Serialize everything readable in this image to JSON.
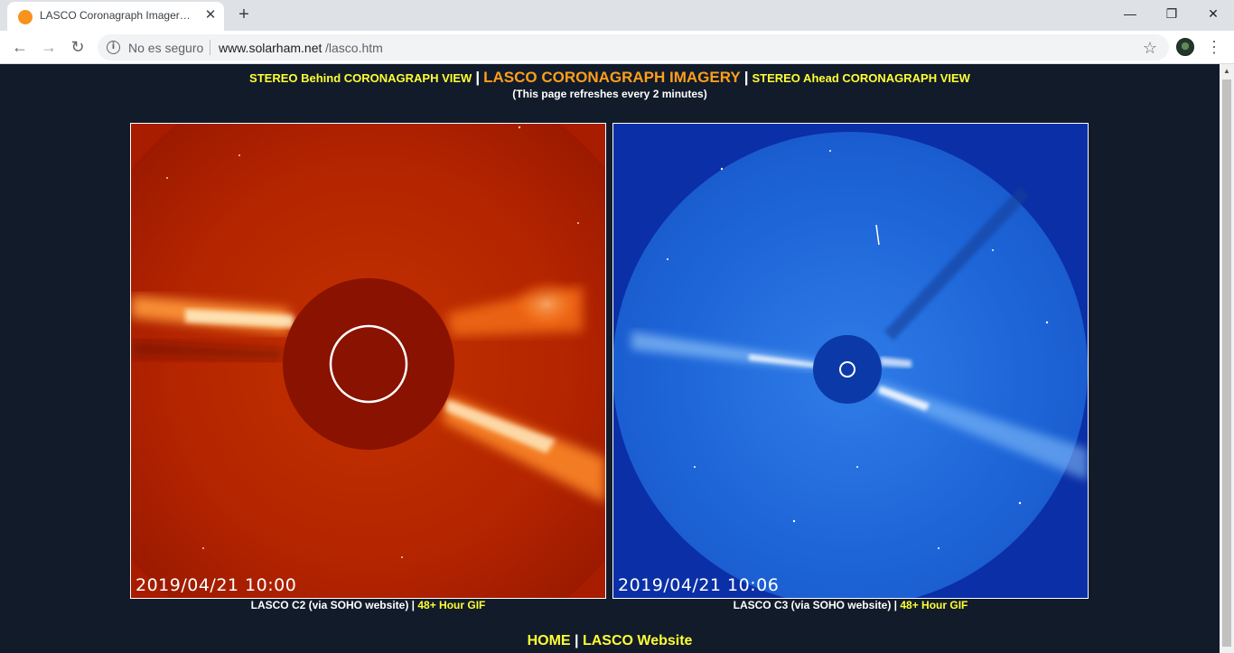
{
  "browser": {
    "tab_title": "LASCO Coronagraph Imagery | Solarham",
    "tab_close": "✕",
    "new_tab": "+",
    "window_controls": {
      "minimize": "—",
      "maximize": "❐",
      "close": "✕"
    },
    "nav": {
      "back": "←",
      "forward": "→",
      "reload": "↻"
    },
    "security_icon": "i",
    "security_text": "No es seguro",
    "url_host": "www.solarham.net",
    "url_path": "/lasco.htm",
    "bookmark_icon": "☆",
    "menu_icon": "⋮"
  },
  "page": {
    "header": {
      "left_link": "STEREO Behind CORONAGRAPH VIEW",
      "separator": "|",
      "title": "LASCO CORONAGRAPH IMAGERY",
      "right_link": "STEREO Ahead CORONAGRAPH VIEW",
      "refresh_note": "(This page refreshes every 2 minutes)"
    },
    "images": {
      "c2": {
        "timestamp": "2019/04/21  10:00",
        "caption": "LASCO C2 (via SOHO website) | ",
        "gif_link": "48+ Hour GIF"
      },
      "c3": {
        "timestamp": "2019/04/21  10:06",
        "caption": "LASCO C3 (via SOHO website) | ",
        "gif_link": "48+ Hour GIF"
      }
    },
    "footer": {
      "home_link": "HOME",
      "separator": " | ",
      "lasco_link": "LASCO Website"
    }
  },
  "colors": {
    "page_background": "#121b2a",
    "link_yellow": "#ffff33",
    "title_orange": "#ff9f1a",
    "c2_red": "#a81c00",
    "c3_blue": "#1f63d6"
  }
}
